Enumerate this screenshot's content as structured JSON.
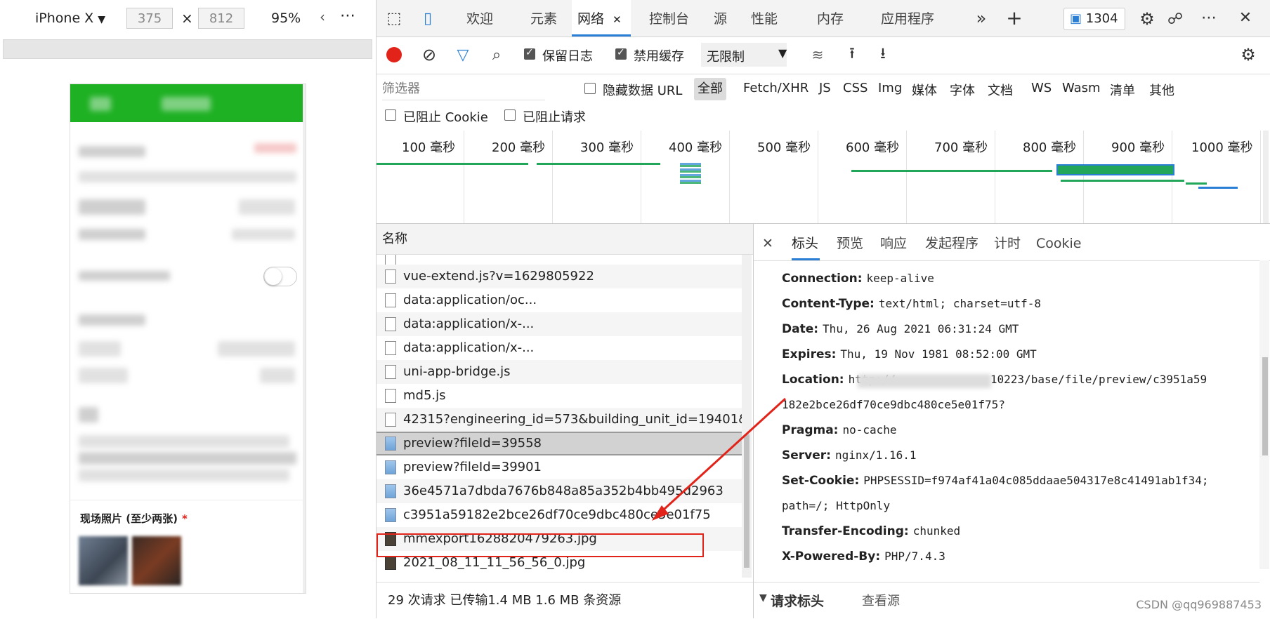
{
  "device_toolbar": {
    "device": "iPhone X",
    "device_caret": "▼",
    "width": "375",
    "times": "×",
    "height": "812",
    "zoom": "95%",
    "more": "⋯"
  },
  "phone": {
    "photo_label": "现场照片 (至少两张)",
    "required_mark": "*"
  },
  "tabs": [
    {
      "label": "欢迎"
    },
    {
      "label": "元素"
    },
    {
      "label": "网络",
      "close": "✕"
    },
    {
      "label": "控制台"
    },
    {
      "label": "源"
    },
    {
      "label": "性能"
    },
    {
      "label": "内存"
    },
    {
      "label": "应用程序"
    }
  ],
  "tab_more": "»",
  "tab_add": "+",
  "issues_count": "1304",
  "network_toolbar": {
    "preserve_log": "保留日志",
    "disable_cache": "禁用缓存",
    "throttle": "无限制"
  },
  "filter": {
    "placeholder": "筛选器",
    "hide_data_urls": "隐藏数据 URL",
    "types": [
      "全部",
      "Fetch/XHR",
      "JS",
      "CSS",
      "Img",
      "媒体",
      "字体",
      "文档",
      "WS",
      "Wasm",
      "清单",
      "其他"
    ],
    "blocked_cookies": "已阻止 Cookie",
    "blocked_requests": "已阻止请求"
  },
  "timeline_ticks": [
    "100 毫秒",
    "200 毫秒",
    "300 毫秒",
    "400 毫秒",
    "500 毫秒",
    "600 毫秒",
    "700 毫秒",
    "800 毫秒",
    "900 毫秒",
    "1000 毫秒"
  ],
  "request_list": {
    "header": "名称",
    "rows": [
      {
        "name": "vue-extend.js?v=1629805922",
        "icon": "script"
      },
      {
        "name": "data:application/oc...",
        "icon": "doc"
      },
      {
        "name": "data:application/x-...",
        "icon": "doc"
      },
      {
        "name": "data:application/x-...",
        "icon": "doc"
      },
      {
        "name": "uni-app-bridge.js",
        "icon": "script"
      },
      {
        "name": "md5.js",
        "icon": "script"
      },
      {
        "name": "42315?engineering_id=573&building_unit_id=19401&...",
        "icon": "doc"
      },
      {
        "name": "preview?fileId=39558",
        "icon": "img"
      },
      {
        "name": "preview?fileId=39901",
        "icon": "img"
      },
      {
        "name": "36e4571a7dbda7676b848a85a352b4bb495d2963",
        "icon": "img"
      },
      {
        "name": "c3951a59182e2bce26df70ce9dbc480ce5e01f75",
        "icon": "img"
      },
      {
        "name": "mmexport1628820479263.jpg",
        "icon": "photo"
      },
      {
        "name": "2021_08_11_11_56_56_0.jpg",
        "icon": "photo"
      }
    ],
    "status": "29 次请求  已传输1.4 MB  1.6 MB 条资源"
  },
  "panel": {
    "close": "✕",
    "tabs": [
      "标头",
      "预览",
      "响应",
      "发起程序",
      "计时",
      "Cookie"
    ],
    "headers": [
      {
        "k": "Connection:",
        "v": "keep-alive"
      },
      {
        "k": "Content-Type:",
        "v": "text/html; charset=utf-8"
      },
      {
        "k": "Date:",
        "v": "Thu, 26 Aug 2021 06:31:24 GMT"
      },
      {
        "k": "Expires:",
        "v": "Thu, 19 Nov 1981 08:52:00 GMT"
      },
      {
        "k": "Location:",
        "v": "http://              10223/base/file/preview/c3951a59"
      },
      {
        "k": "",
        "v": "182e2bce26df70ce9dbc480ce5e01f75?"
      },
      {
        "k": "Pragma:",
        "v": "no-cache"
      },
      {
        "k": "Server:",
        "v": "nginx/1.16.1"
      },
      {
        "k": "Set-Cookie:",
        "v": "PHPSESSID=f974af41a04c085ddaae504317e8c41491ab1f34;"
      },
      {
        "k": "",
        "v": "path=/; HttpOnly"
      },
      {
        "k": "Transfer-Encoding:",
        "v": "chunked"
      },
      {
        "k": "X-Powered-By:",
        "v": "PHP/7.4.3"
      }
    ],
    "request_headers": "请求标头",
    "view_source": "查看源"
  },
  "watermark": "CSDN @qq969887453",
  "colors": {
    "accent": "#2a7fd4",
    "record": "#e2231a",
    "phone_header": "#1fb124",
    "highlight": "#e2231a"
  }
}
